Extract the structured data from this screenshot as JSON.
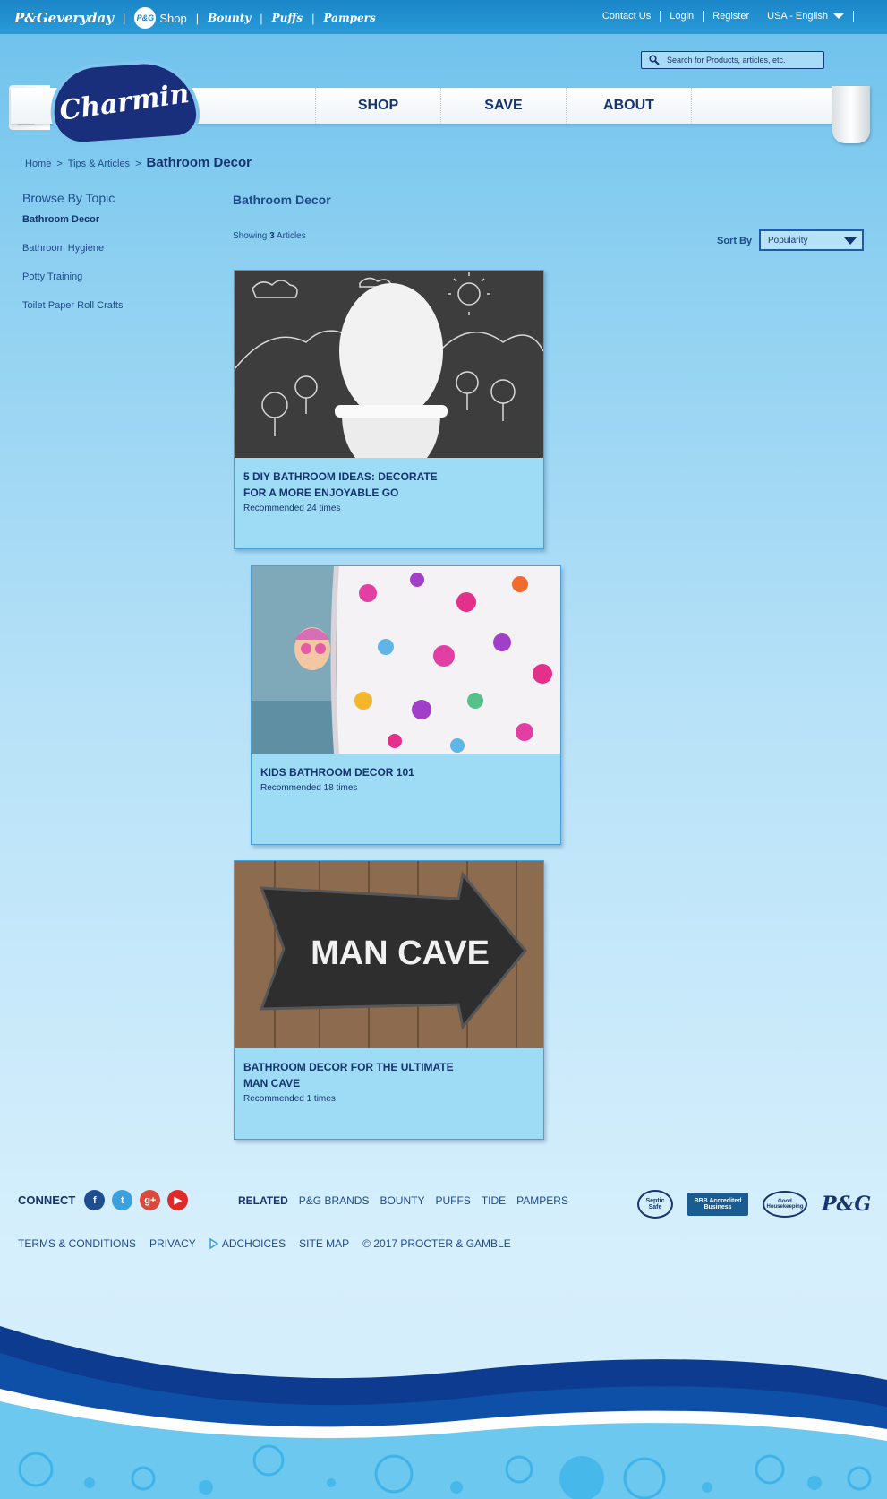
{
  "topbar": {
    "brands": [
      "P&Geveryday",
      "P&G Shop",
      "Bounty",
      "Puffs",
      "Pampers"
    ],
    "links": [
      "Contact Us",
      "Login",
      "Register"
    ],
    "locale": "USA - English"
  },
  "search": {
    "placeholder": "Search for Products, articles, etc."
  },
  "logo": "Charmin",
  "nav": [
    "SHOP",
    "SAVE",
    "ABOUT"
  ],
  "breadcrumb": {
    "home": "Home",
    "tips": "Tips & Articles",
    "current": "Bathroom Decor"
  },
  "sidebar": {
    "heading": "Browse By Topic",
    "items": [
      {
        "label": "Bathroom Decor",
        "active": true
      },
      {
        "label": "Bathroom Hygiene",
        "active": false
      },
      {
        "label": "Potty Training",
        "active": false
      },
      {
        "label": "Toilet Paper Roll Crafts",
        "active": false
      }
    ]
  },
  "main": {
    "title": "Bathroom Decor",
    "showing_prefix": "Showing",
    "showing_count": "3",
    "showing_suffix": "Articles",
    "sort_label": "Sort By",
    "sort_value": "Popularity"
  },
  "articles": [
    {
      "title": "5 DIY Bathroom Ideas: Decorate for a More Enjoyable Go",
      "recommended": "Recommended 24 times",
      "image": "toilet-chalkboard"
    },
    {
      "title": "Kids Bathroom Decor 101",
      "recommended": "Recommended 18 times",
      "image": "kid-shower-curtain"
    },
    {
      "title": "Bathroom Decor for the Ultimate Man Cave",
      "recommended": "Recommended 1 times",
      "image": "man-cave-sign"
    }
  ],
  "image_text": {
    "man_cave_sign": "MAN CAVE"
  },
  "footer": {
    "connect_label": "CONNECT",
    "social": [
      "facebook",
      "twitter",
      "google-plus",
      "youtube"
    ],
    "related_label": "RELATED",
    "related": [
      "P&G BRANDS",
      "BOUNTY",
      "PUFFS",
      "TIDE",
      "PAMPERS"
    ],
    "badges": [
      "Septic Safe",
      "BBB Accredited Business",
      "Good Housekeeping",
      "P&G"
    ],
    "links": [
      "TERMS & CONDITIONS",
      "PRIVACY",
      "ADCHOICES",
      "SITE MAP",
      "© 2017 PROCTER & GAMBLE"
    ]
  },
  "colors": {
    "navy": "#16346f",
    "topbar": "#1a86c8",
    "card": "#9edcf6"
  }
}
